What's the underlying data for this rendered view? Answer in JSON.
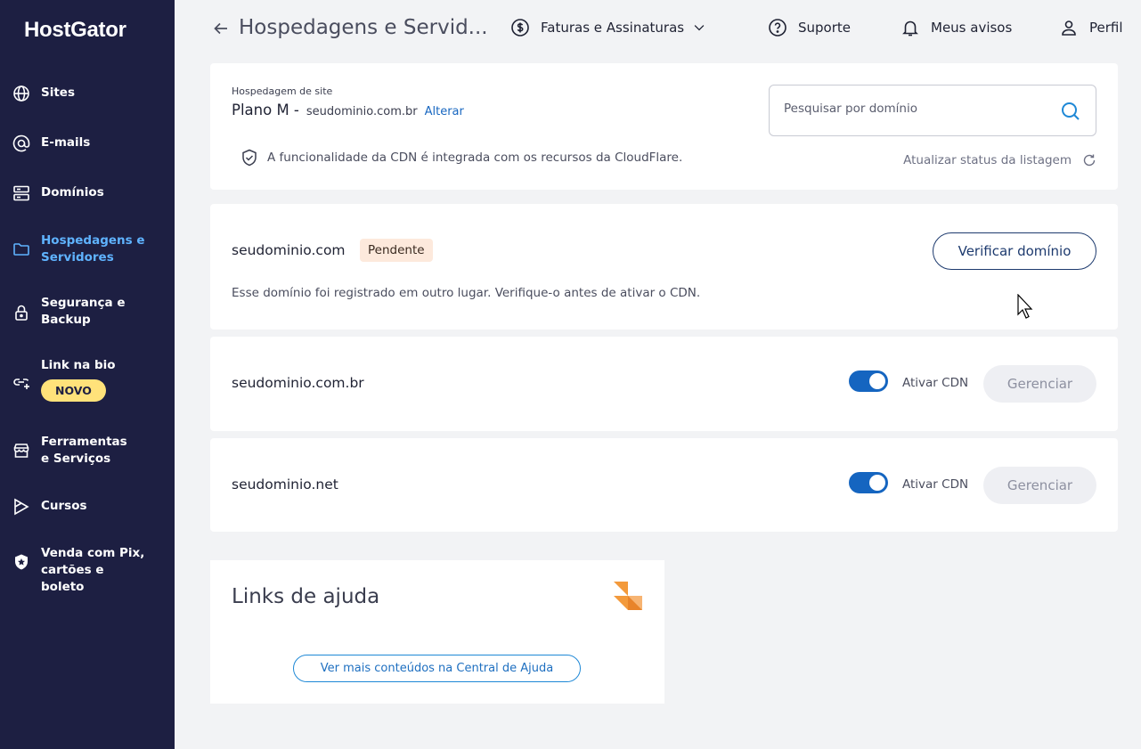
{
  "brand": {
    "logo_text": "HostGator"
  },
  "sidebar": {
    "items": [
      {
        "label": "Sites",
        "icon": "globe-icon"
      },
      {
        "label": "E-mails",
        "icon": "at-icon"
      },
      {
        "label": "Domínios",
        "icon": "server-icon"
      },
      {
        "label": "Hospedagens e Servidores",
        "icon": "folder-icon",
        "active": true
      },
      {
        "label": "Segurança e Backup",
        "icon": "lock-icon"
      },
      {
        "label": "Link na bio",
        "icon": "link-plus-icon",
        "badge": "NOVO"
      },
      {
        "label": "Ferramentas e Serviços",
        "icon": "store-icon"
      },
      {
        "label": "Cursos",
        "icon": "play-icon"
      },
      {
        "label": "Venda com Pix, cartões e boleto",
        "icon": "shield-star-icon"
      }
    ]
  },
  "header": {
    "title": "Hospedagens e Servid...",
    "billing": "Faturas e Assinaturas",
    "support": "Suporte",
    "notices": "Meus avisos",
    "profile": "Perfil"
  },
  "plan": {
    "small_label": "Hospedagem de site",
    "name": "Plano M -",
    "domain": "seudominio.com.br",
    "change": "Alterar",
    "search_placeholder": "Pesquisar por domínio",
    "cdn_info": "A funcionalidade da CDN é integrada com os recursos da CloudFlare.",
    "refresh": "Atualizar status da listagem"
  },
  "domains": [
    {
      "name": "seudominio.com",
      "status": "Pendente",
      "action": "Verificar domínio",
      "note": "Esse domínio foi registrado em outro lugar. Verifique-o antes de ativar o CDN."
    },
    {
      "name": "seudominio.com.br",
      "cdn_label": "Ativar CDN",
      "cdn_enabled": true,
      "action": "Gerenciar"
    },
    {
      "name": "seudominio.net",
      "cdn_label": "Ativar CDN",
      "cdn_enabled": true,
      "action": "Gerenciar"
    }
  ],
  "help": {
    "title": "Links de ajuda",
    "button": "Ver mais conteúdos na Central de Ajuda"
  },
  "colors": {
    "sidebar_bg": "#1d1f42",
    "active": "#5fb3ff",
    "toggle_on": "#1565c0",
    "badge": "#ffe27a",
    "pending_bg": "#fde9dc",
    "logo_orange": "#f39a3c"
  }
}
